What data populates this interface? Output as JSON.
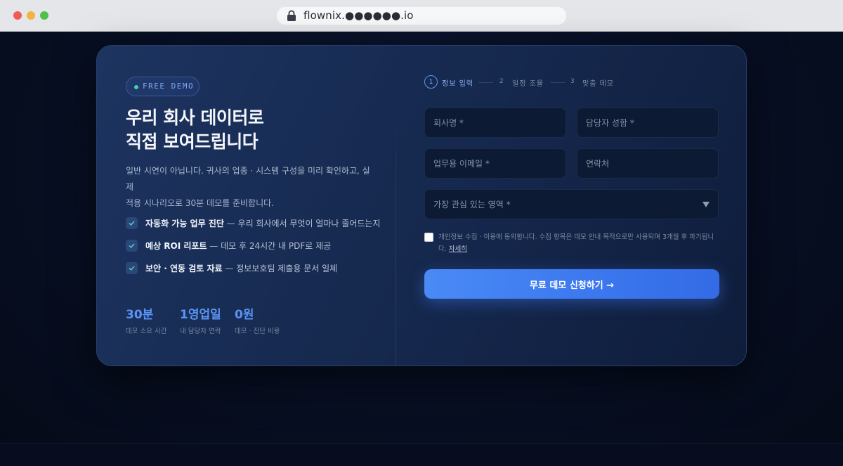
{
  "browser": {
    "url": "flownix.●●●●●●.io"
  },
  "hero": {
    "badge": "FREE DEMO",
    "title_line1": "우리 회사 데이터로",
    "title_line2": "직접 보여드립니다",
    "desc_line1": "일반 시연이 아닙니다. 귀사의 업종 · 시스템 구성을 미리 확인하고, 실제",
    "desc_line2": "적용 시나리오로 30분 데모를 준비합니다."
  },
  "features": [
    {
      "bold": "자동화 가능 업무 진단",
      "rest": " — 우리 회사에서 무엇이 얼마나 줄어드는지"
    },
    {
      "bold": "예상 ROI 리포트",
      "rest": " — 데모 후 24시간 내 PDF로 제공"
    },
    {
      "bold": "보안 · 연동 검토 자료",
      "rest": " — 정보보호팀 제출용 문서 일체"
    }
  ],
  "stats": [
    {
      "value": "30분",
      "label": "데모 소요 시간"
    },
    {
      "value": "1영업일",
      "label": "내 담당자 연락"
    },
    {
      "value": "0원",
      "label": "데모 · 진단 비용"
    }
  ],
  "steps": [
    {
      "num": "1",
      "label": "정보 입력",
      "active": true
    },
    {
      "num": "2",
      "label": "일정 조율",
      "active": false
    },
    {
      "num": "3",
      "label": "맞춤 데모",
      "active": false
    }
  ],
  "form": {
    "company_placeholder": "회사명 *",
    "contact_name_placeholder": "담당자 성함 *",
    "email_placeholder": "업무용 이메일 *",
    "phone_placeholder": "연락처",
    "interest_placeholder": "가장 관심 있는 영역 *",
    "consent_text": "개인정보 수집 · 이용에 동의합니다. 수집 항목은 데모 안내 목적으로만 사용되며 3개월 후 파기됩니다.",
    "consent_link": "자세히",
    "submit_label": "무료 데모 신청하기 →"
  },
  "colors": {
    "accent": "#4a8af5",
    "badge_dot": "#3fd3a5",
    "card_bg": "#172b52"
  }
}
